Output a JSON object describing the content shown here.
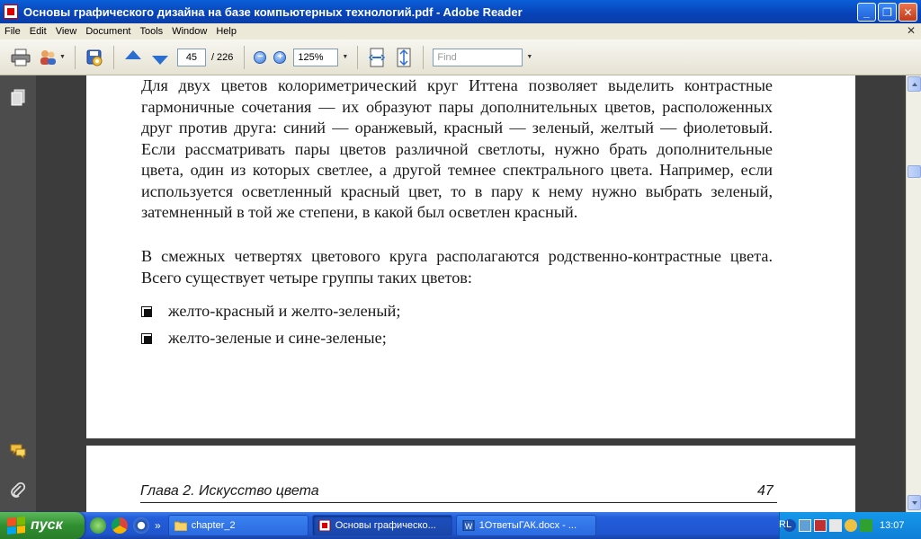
{
  "window": {
    "title": "Основы графического дизайна на базе компьютерных технологий.pdf - Adobe Reader",
    "minimize": "_",
    "maximize": "❐",
    "close": "✕"
  },
  "menu": {
    "items": [
      "File",
      "Edit",
      "View",
      "Document",
      "Tools",
      "Window",
      "Help"
    ],
    "close_doc": "✕"
  },
  "toolbar": {
    "current_page": "45",
    "total_pages": "/ 226",
    "zoom": "125%",
    "find_placeholder": "Find",
    "zoom_out_glyph": "−",
    "zoom_in_glyph": "+"
  },
  "document": {
    "paragraph1": "Для двух цветов колориметрический круг Иттена позволяет выделить контрастные гармоничные сочетания — их образуют пары дополнительных цветов, расположенных друг против друга: синий — оранжевый, красный — зеленый, желтый — фиолетовый. Если рассматривать пары цветов различной светлоты, нужно брать дополнительные цвета, один из которых светлее, а другой темнее спектрального цвета. Например, если используется осветленный красный цвет, то в пару к нему нужно выбрать зеленый, затемненный в той же степени, в какой был осветлен красный.",
    "paragraph2": "В смежных четвертях цветового круга располагаются родственно-контрастные цвета. Всего существует четыре группы таких цветов:",
    "bullets": [
      "желто-красный и желто-зеленый;",
      "желто-зеленые и сине-зеленые;"
    ],
    "footer_chapter": "Глава 2. Искусство цвета",
    "footer_page": "47"
  },
  "taskbar": {
    "start_label": "пуск",
    "more": "»",
    "tasks": [
      {
        "label": "chapter_2",
        "active": false
      },
      {
        "label": "Основы графическо...",
        "active": true
      },
      {
        "label": "1ОтветыГАК.docx - ...",
        "active": false
      }
    ],
    "language": "RL",
    "clock": "13:07"
  },
  "colors": {
    "titlebar": "#0a5fd8",
    "taskbar": "#245edb",
    "start": "#2f8f2f",
    "tray": "#0f7fd6",
    "doc_background": "#3c3c3c"
  }
}
